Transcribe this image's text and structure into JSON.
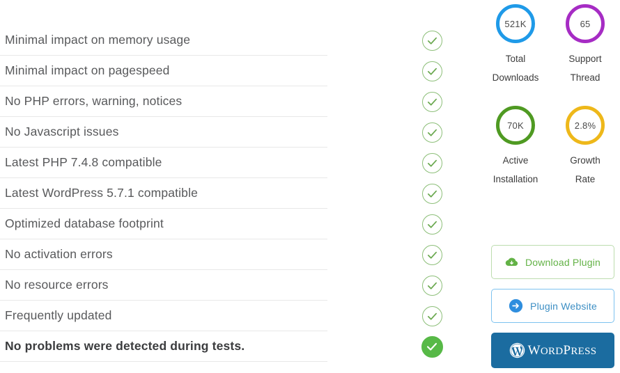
{
  "checklist": {
    "items": [
      {
        "label": "Minimal impact on memory usage",
        "status": "pass",
        "icon": "check-circle-outline-icon",
        "emphasis": false
      },
      {
        "label": "Minimal impact on pagespeed",
        "status": "pass",
        "icon": "check-circle-outline-icon",
        "emphasis": false
      },
      {
        "label": "No PHP errors, warning, notices",
        "status": "pass",
        "icon": "check-circle-outline-icon",
        "emphasis": false
      },
      {
        "label": "No Javascript issues",
        "status": "pass",
        "icon": "check-circle-outline-icon",
        "emphasis": false
      },
      {
        "label": "Latest PHP 7.4.8 compatible",
        "status": "pass",
        "icon": "check-circle-outline-icon",
        "emphasis": false
      },
      {
        "label": "Latest WordPress 5.7.1 compatible",
        "status": "pass",
        "icon": "check-circle-outline-icon",
        "emphasis": false
      },
      {
        "label": "Optimized database footprint",
        "status": "pass",
        "icon": "check-circle-outline-icon",
        "emphasis": false
      },
      {
        "label": "No activation errors",
        "status": "pass",
        "icon": "check-circle-outline-icon",
        "emphasis": false
      },
      {
        "label": "No resource errors",
        "status": "pass",
        "icon": "check-circle-outline-icon",
        "emphasis": false
      },
      {
        "label": "Frequently updated",
        "status": "pass",
        "icon": "check-circle-outline-icon",
        "emphasis": false
      },
      {
        "label": "No problems were detected during tests.",
        "status": "pass-solid",
        "icon": "check-circle-filled-icon",
        "emphasis": true
      }
    ]
  },
  "stats": [
    {
      "value": "521K",
      "label_line1": "Total",
      "label_line2": "Downloads",
      "color": "#1f9ae8"
    },
    {
      "value": "65",
      "label_line1": "Support",
      "label_line2": "Thread",
      "color": "#a62cc4"
    },
    {
      "value": "70K",
      "label_line1": "Active",
      "label_line2": "Installation",
      "color": "#4f9a22"
    },
    {
      "value": "2.8%",
      "label_line1": "Growth",
      "label_line2": "Rate",
      "color": "#eeb81a"
    }
  ],
  "actions": {
    "download": {
      "label": "Download Plugin",
      "icon": "cloud-download-icon",
      "color": "#63b246"
    },
    "website": {
      "label": "Plugin Website",
      "icon": "arrow-right-circle-icon",
      "color": "#2f8ede"
    },
    "wordpress": {
      "label_w": "W",
      "label_ord": "ORD",
      "label_p": "P",
      "label_ress": "RESS",
      "icon": "wordpress-logo-icon",
      "color": "#1b6ca0"
    }
  },
  "colors": {
    "check_outline": "#8dbf79",
    "check_solid": "#57b947",
    "divider": "#e8e8e8",
    "text": "#58595b"
  }
}
